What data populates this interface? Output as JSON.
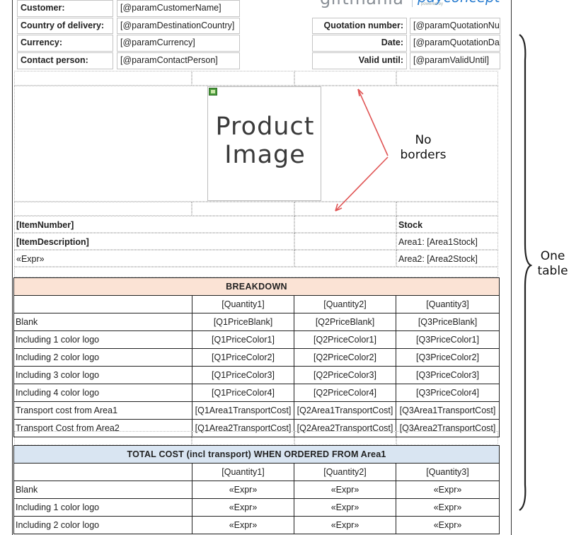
{
  "header": {
    "customer_label": "Customer:",
    "customer_value": "[@paramCustomerName]",
    "country_label": "Country of delivery:",
    "country_value": "[@paramDestinationCountry]",
    "currency_label": "Currency:",
    "currency_value": "[@paramCurrency]",
    "contact_label": "Contact person:",
    "contact_value": "[@paramContactPerson]",
    "quotation_label": "Quotation number:",
    "quotation_value": "[@paramQuotationNu",
    "date_label": "Date:",
    "date_value": "[@paramQuotationDa",
    "valid_label": "Valid until:",
    "valid_value": "[@paramValidUntil]",
    "logo_text": "giftmania",
    "logo_text2": "payconcept",
    "logo_small": "powered by"
  },
  "product": {
    "image_line1": "Product",
    "image_line2": "Image",
    "item_number": "[ItemNumber]",
    "item_description": "[ItemDescription]",
    "expr": "«Expr»",
    "stock_label": "Stock",
    "area1_stock": "Area1: [Area1Stock]",
    "area2_stock": "Area2: [Area2Stock]"
  },
  "breakdown": {
    "title": "BREAKDOWN",
    "quantities": [
      "[Quantity1]",
      "[Quantity2]",
      "[Quantity3]"
    ],
    "rows": [
      {
        "label": "Blank",
        "cells": [
          "[Q1PriceBlank]",
          "[Q2PriceBlank]",
          "[Q3PriceBlank]"
        ]
      },
      {
        "label": "Including 1 color logo",
        "cells": [
          "[Q1PriceColor1]",
          "[Q2PriceColor1]",
          "[Q3PriceColor1]"
        ]
      },
      {
        "label": "Including 2 color logo",
        "cells": [
          "[Q1PriceColor2]",
          "[Q2PriceColor2]",
          "[Q3PriceColor2]"
        ]
      },
      {
        "label": "Including 3 color logo",
        "cells": [
          "[Q1PriceColor3]",
          "[Q2PriceColor3]",
          "[Q3PriceColor3]"
        ]
      },
      {
        "label": "Including 4 color logo",
        "cells": [
          "[Q1PriceColor4]",
          "[Q2PriceColor4]",
          "[Q3PriceColor4]"
        ]
      },
      {
        "label": "Transport cost from Area1",
        "cells": [
          "[Q1Area1TransportCost]",
          "[Q2Area1TransportCost]",
          "[Q3Area1TransportCost]"
        ]
      },
      {
        "label": "Transport Cost from Area2",
        "cells": [
          "[Q1Area2TransportCost]",
          "[Q2Area2TransportCost]",
          "[Q3Area2TransportCost]"
        ]
      }
    ]
  },
  "total": {
    "title": "TOTAL COST (incl transport) WHEN ORDERED FROM Area1",
    "quantities": [
      "[Quantity1]",
      "[Quantity2]",
      "[Quantity3]"
    ],
    "rows": [
      {
        "label": "Blank",
        "cells": [
          "«Expr»",
          "«Expr»",
          "«Expr»"
        ]
      },
      {
        "label": "Including 1 color logo",
        "cells": [
          "«Expr»",
          "«Expr»",
          "«Expr»"
        ]
      },
      {
        "label": "Including 2 color logo",
        "cells": [
          "«Expr»",
          "«Expr»",
          "«Expr»"
        ]
      }
    ]
  },
  "annotations": {
    "no_borders_line1": "No",
    "no_borders_line2": "borders",
    "one_table_line1": "One",
    "one_table_line2": "table",
    "arrow_color": "#e05555"
  }
}
